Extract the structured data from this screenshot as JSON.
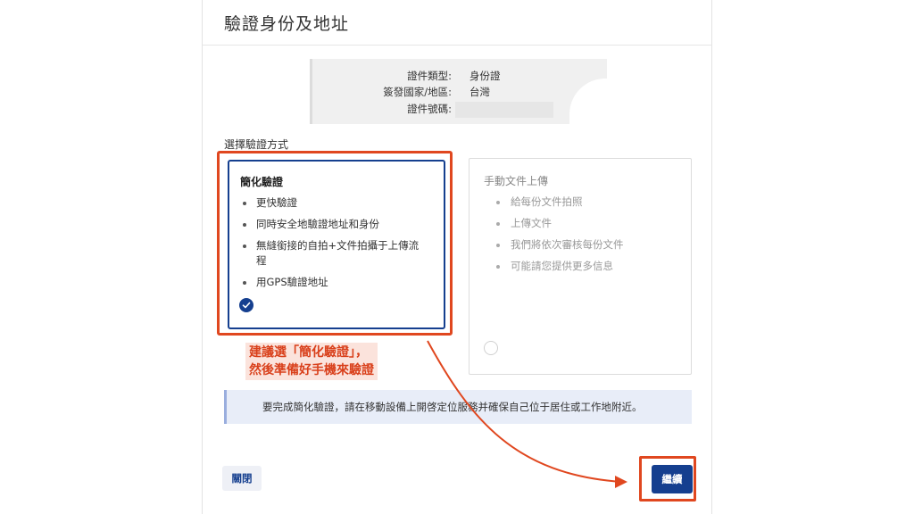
{
  "dialog": {
    "title": "驗證身份及地址",
    "document_info": {
      "type_label": "證件類型:",
      "type_value": "身份證",
      "country_label": "簽發國家/地區:",
      "country_value": "台灣",
      "number_label": "證件號碼:",
      "number_value": ""
    },
    "method_section_label": "選擇驗證方式",
    "methods": [
      {
        "title": "簡化驗證",
        "selected": true,
        "bullets": [
          "更快驗證",
          "同時安全地驗證地址和身份",
          "無縫銜接的自拍+文件拍攝于上傳流程",
          "用GPS驗證地址"
        ]
      },
      {
        "title": "手動文件上傳",
        "selected": false,
        "bullets": [
          "給每份文件拍照",
          "上傳文件",
          "我們將依次審核每份文件",
          "可能請您提供更多信息"
        ]
      }
    ],
    "annotation": {
      "line1": "建議選「簡化驗證」，",
      "line2": "然後準備好手機來驗證"
    },
    "info_message": "要完成簡化驗證，請在移動設備上開啓定位服務并確保自己位于居住或工作地附近。",
    "buttons": {
      "close_label": "關閉",
      "continue_label": "繼續"
    }
  },
  "colors": {
    "primary": "#153f8f",
    "annotation_red": "#e0471f",
    "info_background": "#e8edf8"
  },
  "icons": {
    "selected": "check-circle-icon",
    "unselected": "radio-empty-icon"
  }
}
